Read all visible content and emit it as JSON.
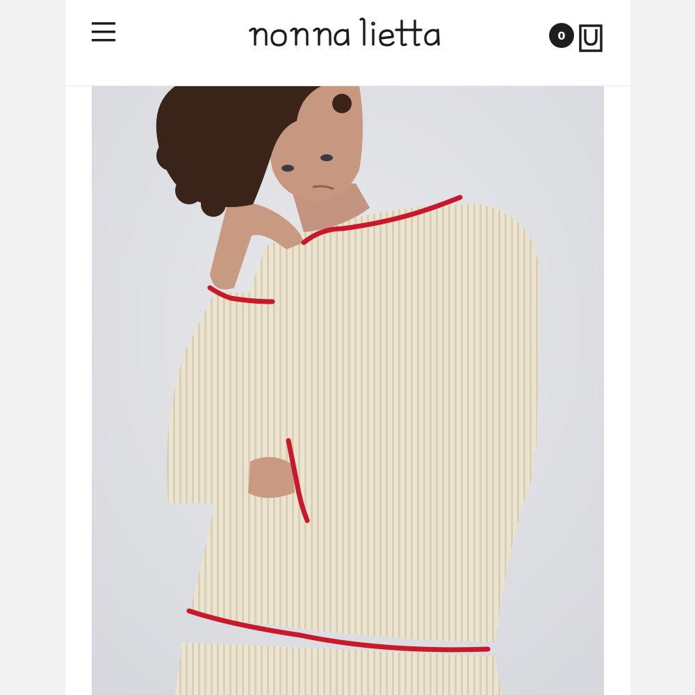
{
  "brand": {
    "logo_text": "nonna lietta"
  },
  "header": {
    "menu_icon": "hamburger-menu-icon",
    "cart_icon": "shopping-bag-icon",
    "cart_count": "0"
  },
  "colors": {
    "page_background": "#f2f2f2",
    "header_background": "#ffffff",
    "ink": "#1d1d1b",
    "photo_backdrop": "#dfe0e4",
    "sweater_cream": "#ece3cf",
    "trim_red": "#c8192a"
  },
  "hero": {
    "image_subject": "model-wearing-cream-ribbed-knit-sweater-with-red-ruffle-trim"
  }
}
